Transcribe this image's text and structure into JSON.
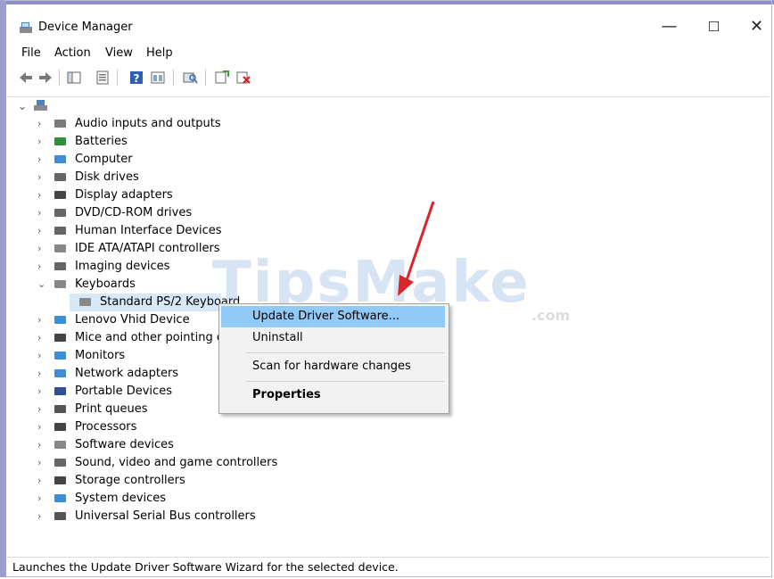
{
  "window": {
    "title": "Device Manager",
    "minimize": "—",
    "maximize": "☐",
    "close": "✕"
  },
  "menu": [
    "File",
    "Action",
    "View",
    "Help"
  ],
  "toolbar": [
    "back-icon",
    "forward-icon",
    "show-hide-console-tree-icon",
    "properties-icon",
    "help-icon",
    "view-icon",
    "scan-icon",
    "update-driver-icon",
    "uninstall-icon"
  ],
  "tree": {
    "items": [
      {
        "label": "Audio inputs and outputs",
        "icon": "speaker-icon"
      },
      {
        "label": "Batteries",
        "icon": "battery-icon"
      },
      {
        "label": "Computer",
        "icon": "computer-icon"
      },
      {
        "label": "Disk drives",
        "icon": "disk-icon"
      },
      {
        "label": "Display adapters",
        "icon": "display-adapter-icon"
      },
      {
        "label": "DVD/CD-ROM drives",
        "icon": "dvd-icon"
      },
      {
        "label": "Human Interface Devices",
        "icon": "hid-icon"
      },
      {
        "label": "IDE ATA/ATAPI controllers",
        "icon": "ide-icon"
      },
      {
        "label": "Imaging devices",
        "icon": "camera-icon"
      },
      {
        "label": "Keyboards",
        "icon": "keyboard-icon"
      },
      {
        "label": "Standard PS/2 Keyboard",
        "icon": "keyboard-icon"
      },
      {
        "label": "Lenovo Vhid Device",
        "icon": "device-icon"
      },
      {
        "label": "Mice and other pointing de",
        "icon": "mouse-icon"
      },
      {
        "label": "Monitors",
        "icon": "monitor-icon"
      },
      {
        "label": "Network adapters",
        "icon": "network-icon"
      },
      {
        "label": "Portable Devices",
        "icon": "portable-icon"
      },
      {
        "label": "Print queues",
        "icon": "printer-icon"
      },
      {
        "label": "Processors",
        "icon": "processor-icon"
      },
      {
        "label": "Software devices",
        "icon": "software-icon"
      },
      {
        "label": "Sound, video and game controllers",
        "icon": "sound-icon"
      },
      {
        "label": "Storage controllers",
        "icon": "storage-icon"
      },
      {
        "label": "System devices",
        "icon": "system-icon"
      },
      {
        "label": "Universal Serial Bus controllers",
        "icon": "usb-icon"
      }
    ]
  },
  "context_menu": {
    "items": [
      "Update Driver Software...",
      "Uninstall",
      "Scan for hardware changes",
      "Properties"
    ]
  },
  "watermark": {
    "main": "TipsMake",
    "suffix": ".com"
  },
  "status": "Launches the Update Driver Software Wizard for the selected device.",
  "colors": {
    "accent": "#91c9f7",
    "selection": "#d7e8f7",
    "arrow": "#d9262b"
  }
}
